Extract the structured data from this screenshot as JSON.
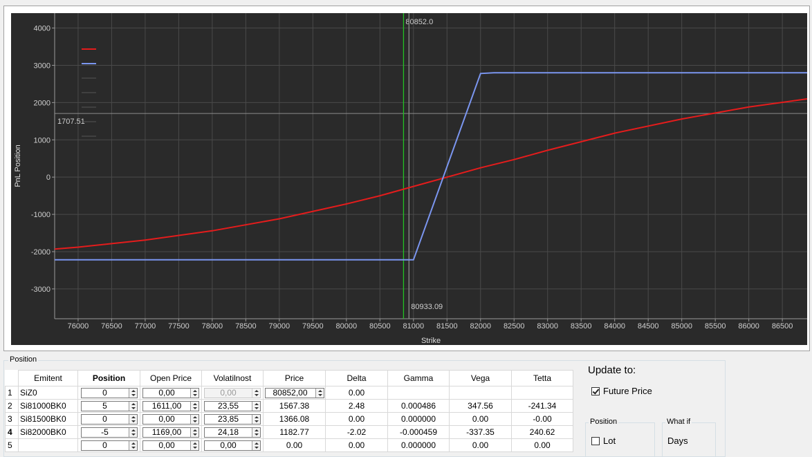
{
  "chart_data": {
    "type": "line",
    "xlabel": "Strike",
    "ylabel": "PnL Position",
    "xlim": [
      75650,
      86870
    ],
    "ylim": [
      -3800,
      4400
    ],
    "x_ticks": [
      76000,
      76500,
      77000,
      77500,
      78000,
      78500,
      79000,
      79500,
      80000,
      80500,
      81000,
      81500,
      82000,
      82500,
      83000,
      83500,
      84000,
      84500,
      85000,
      85500,
      86000,
      86500
    ],
    "y_ticks": [
      -3000,
      -2000,
      -1000,
      0,
      1000,
      2000,
      3000,
      4000
    ],
    "grid": true,
    "background": "#2a2a2a",
    "series": [
      {
        "color": "#e51c1c",
        "x": [
          75650,
          76000,
          77000,
          78000,
          79000,
          80000,
          80500,
          81000,
          81500,
          82000,
          82500,
          83000,
          84000,
          85000,
          86000,
          86870
        ],
        "y": [
          -1930,
          -1880,
          -1690,
          -1440,
          -1120,
          -720,
          -500,
          -250,
          0,
          250,
          470,
          720,
          1180,
          1560,
          1880,
          2100
        ]
      },
      {
        "color": "#7b96f0",
        "x": [
          75650,
          81000,
          82000,
          82200,
          86870
        ],
        "y": [
          -2220,
          -2220,
          2780,
          2800,
          2800
        ]
      }
    ],
    "legend_swatches": [
      "#e51c1c",
      "#7b96f0",
      "#555555",
      "#555555",
      "#555555",
      "#555555",
      "#555555"
    ],
    "vlines": [
      {
        "x": 80852.0,
        "color": "#22c322",
        "label": "80852.0"
      },
      {
        "x": 80933.09,
        "color": "#8c8c8c",
        "label": "80933.09"
      }
    ],
    "hline": {
      "y": 1707.51,
      "color": "#8c8c8c",
      "label": "1707.51"
    }
  },
  "position_group": {
    "title": "Position"
  },
  "table": {
    "headers": [
      "Emitent",
      "Position",
      "Open Price",
      "Volatilnost",
      "Price",
      "Delta",
      "Gamma",
      "Vega",
      "Tetta"
    ],
    "rows": [
      {
        "num": "1",
        "emitent": "SiZ0",
        "position": "0",
        "open_price": "0,00",
        "vol": "0,00",
        "price": "80852,00",
        "delta": "0.00",
        "gamma": "",
        "vega": "",
        "tetta": ""
      },
      {
        "num": "2",
        "emitent": "Si81000BK0",
        "position": "5",
        "open_price": "1611,00",
        "vol": "23,55",
        "price": "1567.38",
        "delta": "2.48",
        "gamma": "0.000486",
        "vega": "347.56",
        "tetta": "-241.34"
      },
      {
        "num": "3",
        "emitent": "Si81500BK0",
        "position": "0",
        "open_price": "0,00",
        "vol": "23,85",
        "price": "1366.08",
        "delta": "0.00",
        "gamma": "0.000000",
        "vega": "0.00",
        "tetta": "-0.00"
      },
      {
        "num": "4",
        "emitent": "Si82000BK0",
        "position": "-5",
        "open_price": "1169,00",
        "vol": "24,18",
        "price": "1182.77",
        "delta": "-2.02",
        "gamma": "-0.000459",
        "vega": "-337.35",
        "tetta": "240.62"
      },
      {
        "num": "5",
        "emitent": "",
        "position": "0",
        "open_price": "0,00",
        "vol": "0,00",
        "price": "0.00",
        "delta": "0.00",
        "gamma": "0.000000",
        "vega": "0.00",
        "tetta": "0.00"
      }
    ]
  },
  "update": {
    "title": "Update to:",
    "future_price_label": "Future Price",
    "future_price_checked": true,
    "position_box_title": "Position",
    "lot_label": "Lot",
    "lot_checked": false,
    "whatif_box_title": "What if",
    "days_label": "Days"
  }
}
